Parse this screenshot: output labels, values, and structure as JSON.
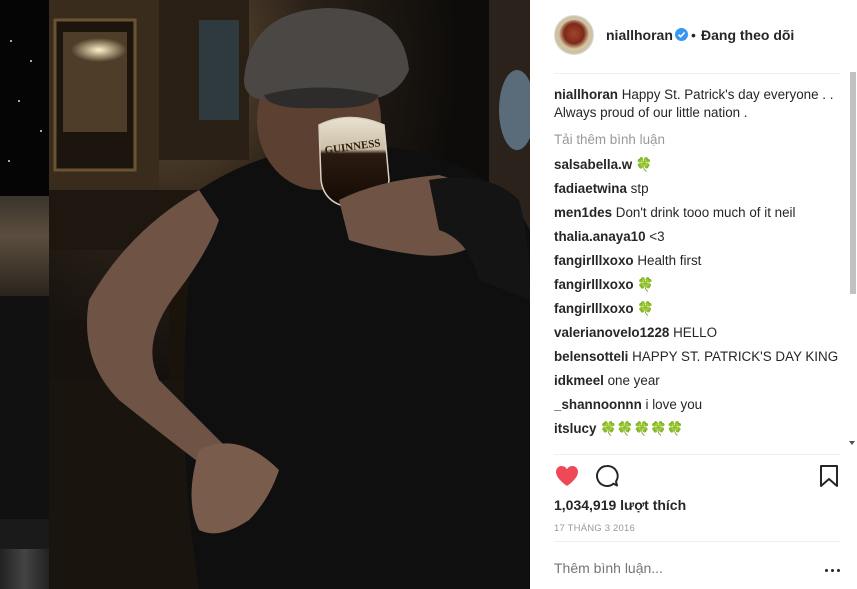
{
  "post": {
    "username": "niallhoran",
    "separator": "•",
    "follow_status": "Đang theo dõi",
    "caption_user": "niallhoran",
    "caption_text": "Happy St. Patrick's day everyone . . Always proud of our little nation .",
    "load_more": "Tải thêm bình luận",
    "likes": "1,034,919 lượt thích",
    "date": "17 THÁNG 3 2016",
    "add_comment_placeholder": "Thêm bình luận...",
    "photo_text": "GUINNESS",
    "liked_color": "#ed4956",
    "verified_color": "#3897f0"
  },
  "comments": [
    {
      "user": "salsabella.w",
      "text": "🍀"
    },
    {
      "user": "fadiaetwina",
      "text": "stp"
    },
    {
      "user": "men1des",
      "text": "Don't drink tooo much of it neil"
    },
    {
      "user": "thalia.anaya10",
      "text": "<3"
    },
    {
      "user": "fangirlllxoxo",
      "text": "Health first"
    },
    {
      "user": "fangirlllxoxo",
      "text": "🍀"
    },
    {
      "user": "fangirlllxoxo",
      "text": "🍀"
    },
    {
      "user": "valerianovelo1228",
      "text": "HELLO"
    },
    {
      "user": "belensotteli",
      "text": "HAPPY ST. PATRICK'S DAY KING"
    },
    {
      "user": "idkmeel",
      "text": "one year"
    },
    {
      "user": "_shannoonnn",
      "text": "i love you"
    },
    {
      "user": "itslucy",
      "text": "🍀🍀🍀🍀🍀"
    }
  ]
}
